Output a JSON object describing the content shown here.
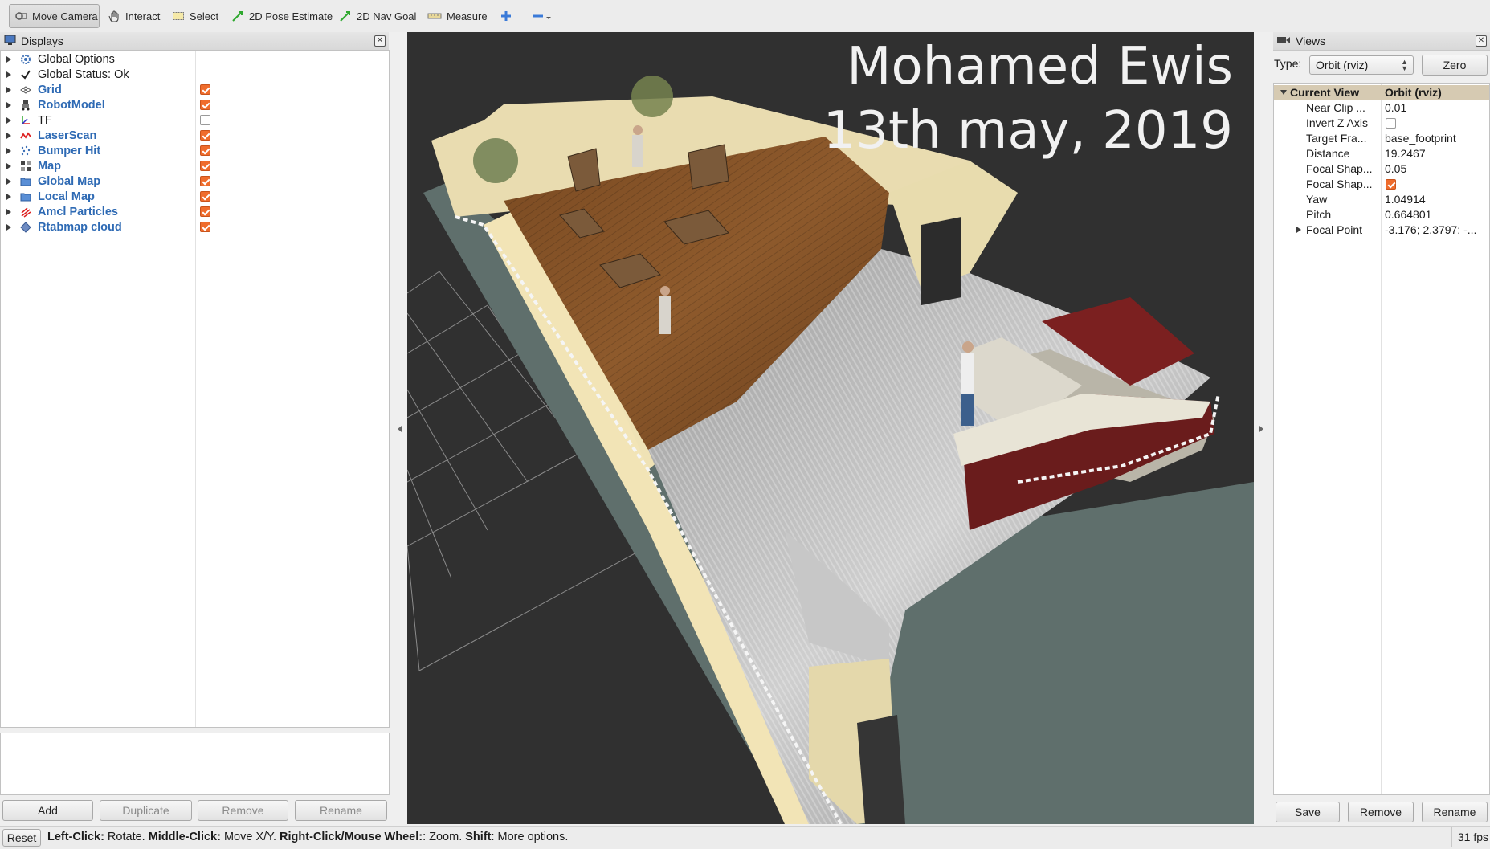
{
  "toolbar": {
    "tools": [
      "Move Camera",
      "Interact",
      "Select",
      "2D Pose Estimate",
      "2D Nav Goal",
      "Measure"
    ]
  },
  "displays": {
    "title": "Displays",
    "items": [
      {
        "label": "Global Options",
        "icon": "gear-icon",
        "checked": null,
        "bold": false
      },
      {
        "label": "Global Status: Ok",
        "icon": "check-icon",
        "checked": null,
        "bold": false
      },
      {
        "label": "Grid",
        "icon": "grid-icon",
        "checked": true,
        "bold": true
      },
      {
        "label": "RobotModel",
        "icon": "robot-icon",
        "checked": true,
        "bold": true
      },
      {
        "label": "TF",
        "icon": "axes-icon",
        "checked": false,
        "bold": false
      },
      {
        "label": "LaserScan",
        "icon": "laser-icon",
        "checked": true,
        "bold": true
      },
      {
        "label": "Bumper Hit",
        "icon": "points-icon",
        "checked": true,
        "bold": true
      },
      {
        "label": "Map",
        "icon": "map-icon",
        "checked": true,
        "bold": true
      },
      {
        "label": "Global Map",
        "icon": "folder-icon",
        "checked": true,
        "bold": true
      },
      {
        "label": "Local Map",
        "icon": "folder-icon",
        "checked": true,
        "bold": true
      },
      {
        "label": "Amcl Particles",
        "icon": "particles-icon",
        "checked": true,
        "bold": true
      },
      {
        "label": "Rtabmap cloud",
        "icon": "cloud-icon",
        "checked": true,
        "bold": true
      }
    ],
    "buttons": {
      "add": "Add",
      "duplicate": "Duplicate",
      "remove": "Remove",
      "rename": "Rename"
    }
  },
  "viewport": {
    "overlay_line1": "Mohamed Ewis",
    "overlay_line2": "13th may, 2019"
  },
  "views": {
    "title": "Views",
    "type_label": "Type:",
    "type_value": "Orbit (rviz)",
    "zero_button": "Zero",
    "current_view": {
      "key": "Current View",
      "value": "Orbit (rviz)"
    },
    "properties": [
      {
        "key": "Near Clip ...",
        "value": "0.01"
      },
      {
        "key": "Invert Z Axis",
        "value": "",
        "checkbox": false
      },
      {
        "key": "Target Fra...",
        "value": "base_footprint"
      },
      {
        "key": "Distance",
        "value": "19.2467"
      },
      {
        "key": "Focal Shap...",
        "value": "0.05"
      },
      {
        "key": "Focal Shap...",
        "value": "",
        "checkbox": true
      },
      {
        "key": "Yaw",
        "value": "1.04914"
      },
      {
        "key": "Pitch",
        "value": "0.664801"
      },
      {
        "key": "Focal Point",
        "value": "-3.176; 2.3797; -..."
      }
    ],
    "buttons": {
      "save": "Save",
      "remove": "Remove",
      "rename": "Rename"
    }
  },
  "status": {
    "reset": "Reset",
    "hint_parts": [
      {
        "b": "Left-Click:",
        "t": " Rotate. "
      },
      {
        "b": "Middle-Click:",
        "t": " Move X/Y. "
      },
      {
        "b": "Right-Click/Mouse Wheel:",
        "t": ": Zoom. "
      },
      {
        "b": "Shift",
        "t": ": More options."
      }
    ],
    "fps": "31 fps"
  },
  "colors": {
    "accent_check": "#ef6c2c",
    "link_blue": "#2e6ab4",
    "viewport_bg": "#303030"
  }
}
